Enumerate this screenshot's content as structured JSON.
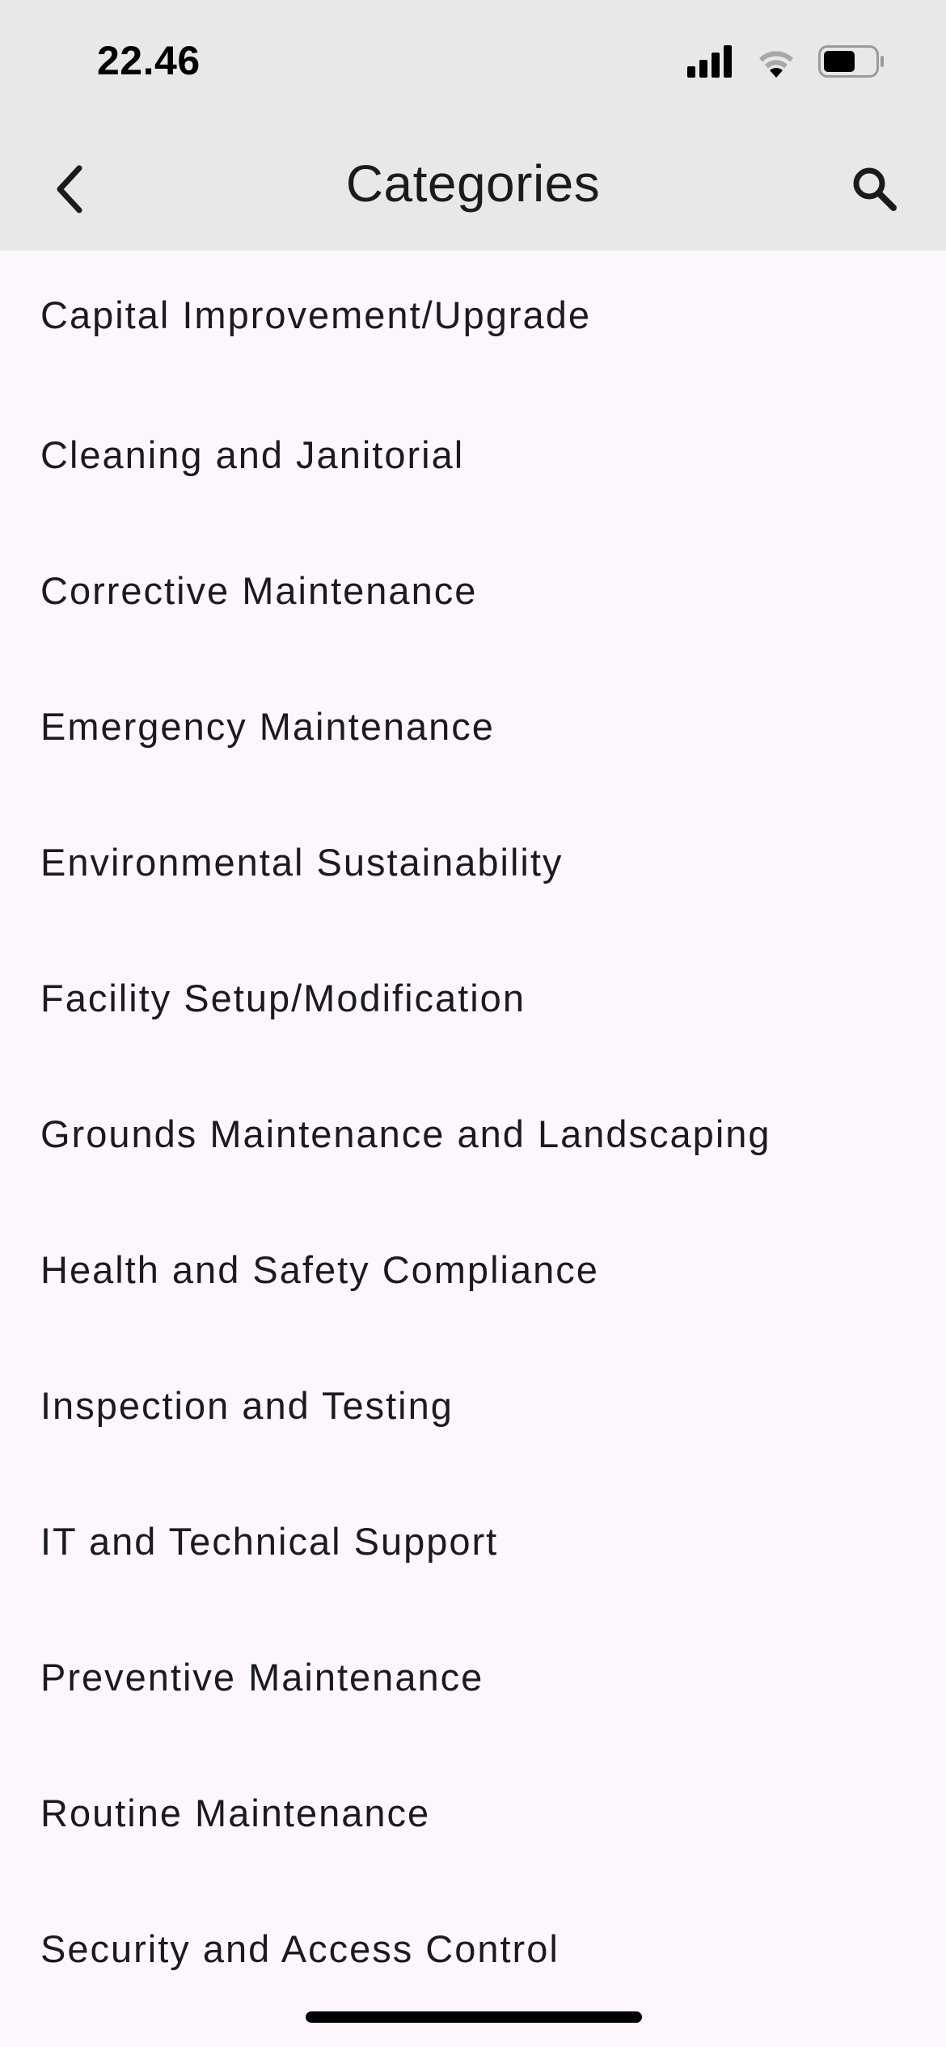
{
  "status_bar": {
    "time": "22.46",
    "icons": [
      "cellular-signal-icon",
      "wifi-icon",
      "battery-icon"
    ]
  },
  "app_bar": {
    "title": "Categories",
    "back_icon": "chevron-left-icon",
    "search_icon": "search-icon"
  },
  "categories": [
    {
      "label": "Capital Improvement/Upgrade"
    },
    {
      "label": "Cleaning and Janitorial"
    },
    {
      "label": "Corrective Maintenance"
    },
    {
      "label": "Emergency Maintenance"
    },
    {
      "label": "Environmental Sustainability"
    },
    {
      "label": "Facility Setup/Modification"
    },
    {
      "label": "Grounds Maintenance and Landscaping"
    },
    {
      "label": "Health and Safety Compliance"
    },
    {
      "label": "Inspection and Testing"
    },
    {
      "label": "IT and Technical Support"
    },
    {
      "label": "Preventive Maintenance"
    },
    {
      "label": "Routine Maintenance"
    },
    {
      "label": "Security and Access Control"
    }
  ],
  "colors": {
    "background": "#fdf7fd",
    "app_bar": "#e8e8e8",
    "text": "#1b1b1f"
  }
}
